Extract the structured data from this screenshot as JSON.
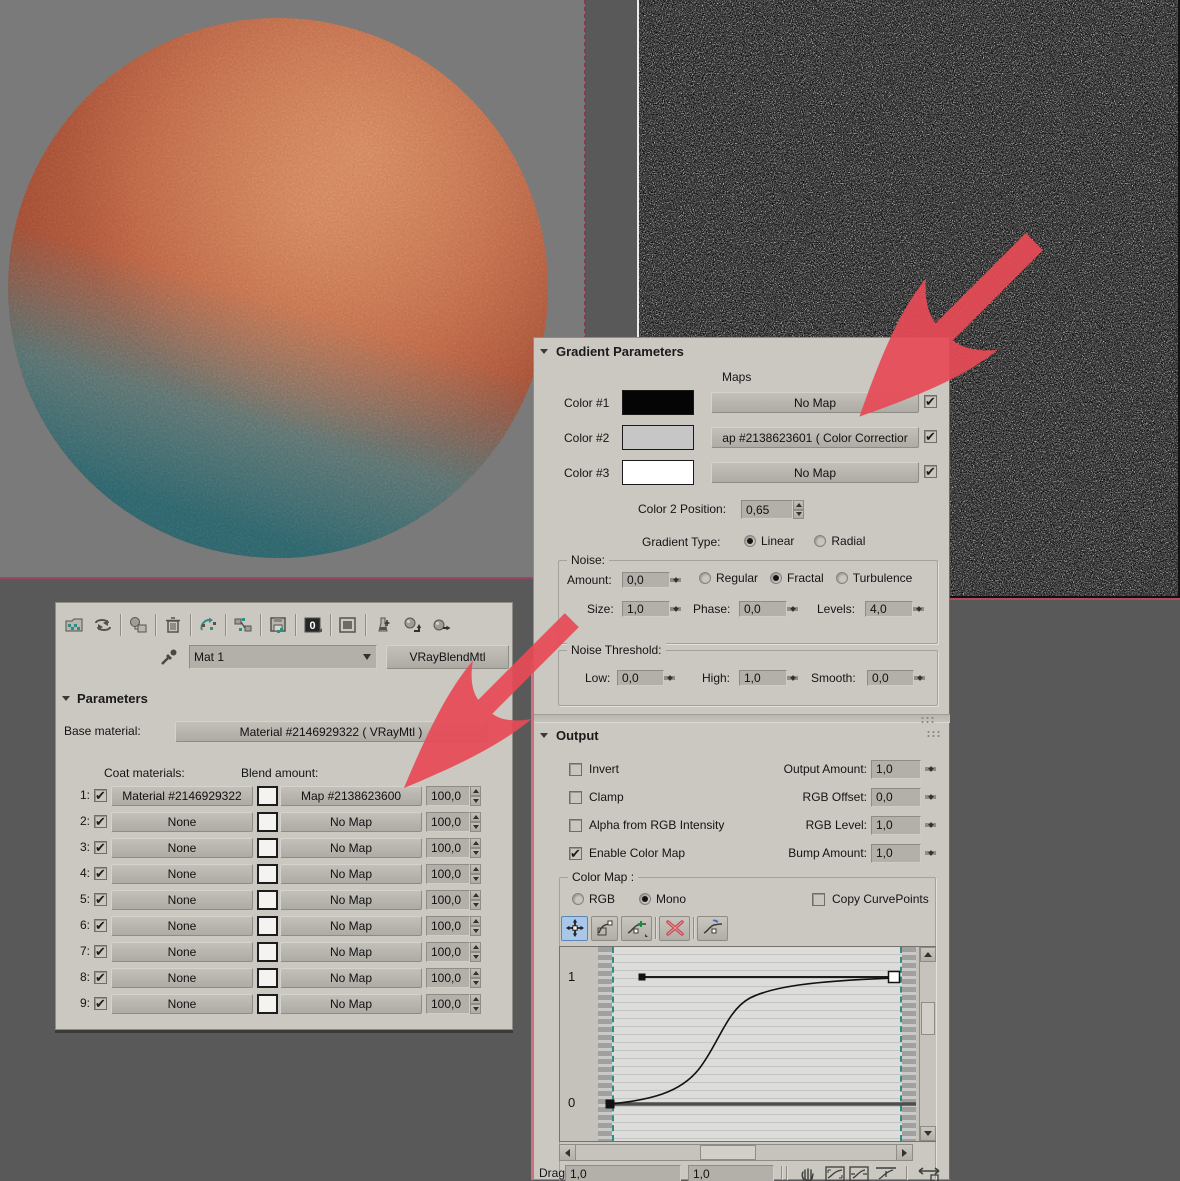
{
  "colors": {
    "accent_red": "#e64a56",
    "panel_bg": "#cbc8c2",
    "button_bg": "#b7b4ae",
    "selected_tool_bg": "#a9c7e8",
    "teal_accent": "#2f8d82",
    "sphere_orange": "#b55b3e",
    "sphere_teal": "#3f7d82",
    "preview_bg": "#7a7a7a",
    "desktop_bg": "#595959"
  },
  "material_editor": {
    "toolbar_icons": [
      "get-material",
      "put-material-to-scene",
      "assign-material-to-selection",
      "reset-map",
      "make-material-copy",
      "make-unique",
      "put-to-library",
      "material-id-channel",
      "show-map-in-viewport",
      "show-end-result",
      "go-to-parent",
      "go-forward-to-sibling"
    ],
    "picker_icon": "eyedropper",
    "name_field": "Mat 1",
    "type_button": "VRayBlendMtl",
    "parameters_title": "Parameters",
    "base_material_label": "Base material:",
    "base_material_button": "Material #2146929322  ( VRayMtl )",
    "coat_materials_label": "Coat materials:",
    "blend_amount_label": "Blend amount:",
    "coat_rows": [
      {
        "index": "1:",
        "checked": true,
        "material": "Material #2146929322",
        "map": "Map #2138623600",
        "amount": "100,0"
      },
      {
        "index": "2:",
        "checked": true,
        "material": "None",
        "map": "No Map",
        "amount": "100,0"
      },
      {
        "index": "3:",
        "checked": true,
        "material": "None",
        "map": "No Map",
        "amount": "100,0"
      },
      {
        "index": "4:",
        "checked": true,
        "material": "None",
        "map": "No Map",
        "amount": "100,0"
      },
      {
        "index": "5:",
        "checked": true,
        "material": "None",
        "map": "No Map",
        "amount": "100,0"
      },
      {
        "index": "6:",
        "checked": true,
        "material": "None",
        "map": "No Map",
        "amount": "100,0"
      },
      {
        "index": "7:",
        "checked": true,
        "material": "None",
        "map": "No Map",
        "amount": "100,0"
      },
      {
        "index": "8:",
        "checked": true,
        "material": "None",
        "map": "No Map",
        "amount": "100,0"
      },
      {
        "index": "9:",
        "checked": true,
        "material": "None",
        "map": "No Map",
        "amount": "100,0"
      }
    ]
  },
  "gradient_parameters": {
    "title": "Gradient Parameters",
    "maps_label": "Maps",
    "color_rows": [
      {
        "label": "Color #1",
        "swatch": "#050505",
        "map": "No Map",
        "checked": true
      },
      {
        "label": "Color #2",
        "swatch": "#c6c6c6",
        "map": "ap #2138623601  ( Color Correctior",
        "checked": true
      },
      {
        "label": "Color #3",
        "swatch": "#ffffff",
        "map": "No Map",
        "checked": true
      }
    ],
    "color2_position_label": "Color 2 Position:",
    "color2_position_value": "0,65",
    "gradient_type_label": "Gradient Type:",
    "type_options": [
      {
        "label": "Linear",
        "selected": true
      },
      {
        "label": "Radial",
        "selected": false
      }
    ],
    "noise_group": {
      "label": "Noise:",
      "amount_label": "Amount:",
      "amount": "0,0",
      "types": [
        {
          "label": "Regular",
          "selected": false
        },
        {
          "label": "Fractal",
          "selected": true
        },
        {
          "label": "Turbulence",
          "selected": false
        }
      ],
      "size_label": "Size:",
      "size": "1,0",
      "phase_label": "Phase:",
      "phase": "0,0",
      "levels_label": "Levels:",
      "levels": "4,0"
    },
    "threshold_group": {
      "label": "Noise Threshold:",
      "low_label": "Low:",
      "low": "0,0",
      "high_label": "High:",
      "high": "1,0",
      "smooth_label": "Smooth:",
      "smooth": "0,0"
    }
  },
  "output": {
    "title": "Output",
    "checkboxes": [
      {
        "label": "Invert",
        "checked": false
      },
      {
        "label": "Clamp",
        "checked": false
      },
      {
        "label": "Alpha from RGB Intensity",
        "checked": false
      },
      {
        "label": "Enable Color Map",
        "checked": true
      }
    ],
    "spinners": [
      {
        "label": "Output Amount:",
        "value": "1,0"
      },
      {
        "label": "RGB Offset:",
        "value": "0,0"
      },
      {
        "label": "RGB Level:",
        "value": "1,0"
      },
      {
        "label": "Bump Amount:",
        "value": "1,0"
      }
    ],
    "color_map": {
      "group_label": "Color Map :",
      "modes": [
        {
          "label": "RGB",
          "selected": false
        },
        {
          "label": "Mono",
          "selected": true
        }
      ],
      "copy_label": "Copy CurvePoints",
      "copy_checked": false,
      "curve_toolbar_icons": [
        "move-point",
        "scale-point",
        "add-point",
        "delete-point",
        "reset-curve"
      ],
      "y_max_label": "1",
      "y_min_label": "0",
      "curve": {
        "y_range": [
          0,
          1
        ],
        "points": [
          [
            0.04,
            0.0
          ],
          [
            0.3,
            0.12
          ],
          [
            0.45,
            0.45
          ],
          [
            0.6,
            0.78
          ],
          [
            0.8,
            0.95
          ],
          [
            1.0,
            1.0
          ]
        ],
        "shape": "s-curve"
      },
      "bottom_bar": {
        "drag_label": "Drag",
        "x_value": "1,0",
        "y_value": "1,0",
        "icons": [
          "pan",
          "zoom-extents",
          "zoom-horizontal-extents",
          "zoom-vertical-extents",
          "zoom-region"
        ]
      }
    }
  }
}
